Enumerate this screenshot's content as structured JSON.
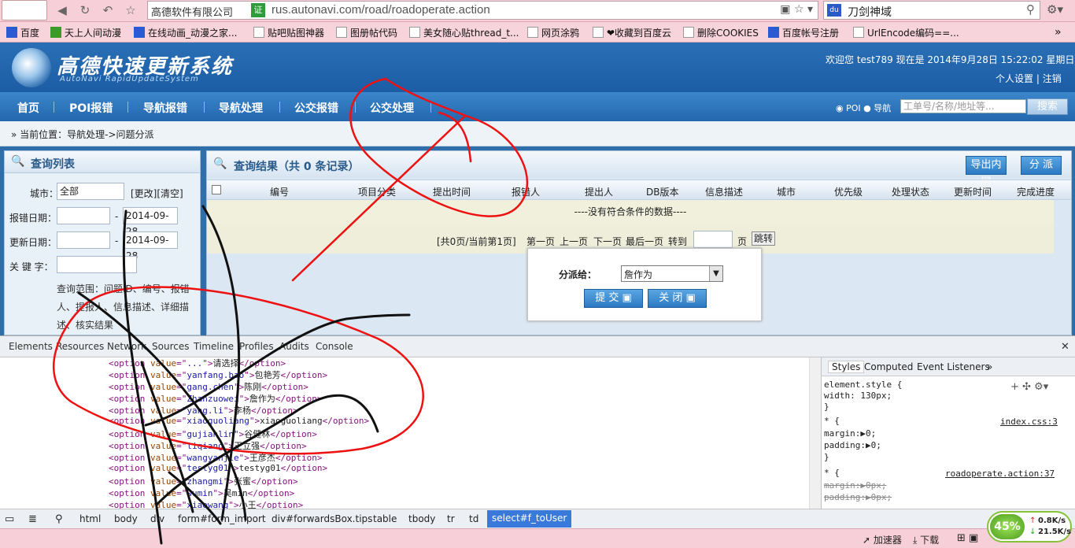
{
  "browser": {
    "site_name": "高德软件有限公司",
    "cert_label": "证",
    "url": "rus.autonavi.com/road/roadoperate.action",
    "search_text": "刀剑神域",
    "bookmarks": [
      {
        "label": "百度",
        "icon": "baidu-icon"
      },
      {
        "label": "天上人间动漫",
        "icon": "green-icon"
      },
      {
        "label": "在线动画_动漫之家...",
        "icon": "blue-icon"
      },
      {
        "label": "贴吧贴图神器",
        "icon": "page-icon"
      },
      {
        "label": "图册帖代码",
        "icon": "page-icon"
      },
      {
        "label": "美女随心贴thread_t...",
        "icon": "page-icon"
      },
      {
        "label": "网页涂鸦",
        "icon": "page-icon"
      },
      {
        "label": "❤收藏到百度云",
        "icon": "page-icon"
      },
      {
        "label": "删除COOKIES",
        "icon": "page-icon"
      },
      {
        "label": "百度帐号注册",
        "icon": "baidu-icon"
      },
      {
        "label": "UrlEncode编码==...",
        "icon": "page-icon"
      }
    ]
  },
  "site": {
    "logo_text": "高德快速更新系统",
    "logo_sub": "AutoNavi RapidUpdateSystem",
    "welcome": "欢迎您 test789 现在是 2014年9月28日 15:22:02 星期日",
    "personal_settings": "个人设置",
    "logout": "注销",
    "nav": [
      "首页",
      "POI报错",
      "导航报错",
      "导航处理",
      "公交报错",
      "公交处理"
    ],
    "radio_poi": "POI",
    "radio_nav": "导航",
    "search_placeholder": "工单号/名称/地址等...",
    "search_button": "搜索",
    "breadcrumb": "当前位置：导航处理->问题分派"
  },
  "query": {
    "title": "查询列表",
    "city_label": "城市：",
    "city_value": "全部",
    "city_links": "[更改][清空]",
    "report_date_label": "报错日期：",
    "report_date_to": "2014-09-28",
    "update_date_label": "更新日期：",
    "update_date_to": "2014-09-28",
    "keyword_label": "关 键 字：",
    "scope_text": "查询范围：问题ID、编号、报错人、提报人、信息描述、详细描述、核实结果",
    "dash": "-"
  },
  "results": {
    "title": "查询结果（共 0 条记录）",
    "export_button": "导出内网",
    "assign_button": "分 派",
    "columns": [
      "编号",
      "项目分类",
      "提出时间",
      "报错人",
      "提出人",
      "DB版本",
      "信息描述",
      "城市",
      "优先级",
      "处理状态",
      "更新时间",
      "完成进度"
    ],
    "empty_text": "----没有符合条件的数据----",
    "pager_info": "[共0页/当前第1页]",
    "pager_first": "第一页",
    "pager_prev": "上一页",
    "pager_next": "下一页",
    "pager_last": "最后一页",
    "pager_goto": "转到",
    "pager_page": "页",
    "pager_jump": "跳转"
  },
  "dialog": {
    "label": "分派给：",
    "selected": "詹作为",
    "submit": "提 交",
    "close": "关 闭"
  },
  "devtools": {
    "tabs": [
      "Elements",
      "Resources",
      "Network",
      "Sources",
      "Timeline",
      "Profiles",
      "Audits",
      "Console"
    ],
    "code_lines": [
      {
        "val": "...",
        "txt": "请选择"
      },
      {
        "val": "yanfang.bao",
        "txt": "包艳芳"
      },
      {
        "val": "gang.chen",
        "txt": "陈刚"
      },
      {
        "val": "Zhanzuowei",
        "txt": "詹作为"
      },
      {
        "val": "yang.li",
        "txt": "李杨"
      },
      {
        "val": "xiaoguoliang",
        "txt": "xiaoguoliang"
      },
      {
        "val": "gujianlin",
        "txt": "谷健林"
      },
      {
        "val": "liqiang",
        "txt": "王立强"
      },
      {
        "val": "wangyanjie",
        "txt": "王彦杰"
      },
      {
        "val": "testyg01",
        "txt": "testyg01"
      },
      {
        "val": "zhangmi",
        "txt": "张蜜"
      },
      {
        "val": "wumin",
        "txt": "吴min"
      },
      {
        "val": "xiaowang",
        "txt": "小王"
      }
    ],
    "styles_tabs": [
      "Styles",
      "Computed",
      "Event Listeners",
      "»"
    ],
    "styles_lines": [
      "element.style {",
      "  width: 130px;",
      "}",
      "* {",
      "  margin:▶0;",
      "  padding:▶0;",
      "}",
      "* {",
      "  margin:▶0px;",
      "  padding:▶0px;"
    ],
    "styles_src1": "index.css:3",
    "styles_src2": "roadoperate.action:37",
    "crumbs": [
      "html",
      "body",
      "div",
      "form#form_import",
      "div#forwardsBox.tips",
      "table",
      "tbody",
      "tr",
      "td"
    ],
    "crumb_active": "select#f_toUser"
  },
  "status": {
    "accelerator": "加速器",
    "download": "下载",
    "percent": "45%",
    "up": "0.8K/s",
    "down": "21.5K/s"
  }
}
